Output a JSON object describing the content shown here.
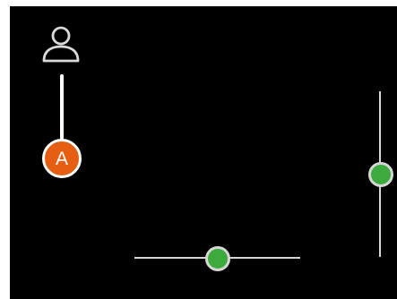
{
  "colors": {
    "screen_background": "#000000",
    "outer_background": "#ffffff",
    "badge_fill": "#e55e12",
    "badge_border": "#ffffff",
    "knob_fill": "#3daa3d",
    "knob_border": "#d6d6d6",
    "track": "#d8d8d8"
  },
  "icons": {
    "profile": "user-icon"
  },
  "badge": {
    "letter": "A"
  },
  "sliders": {
    "horizontal": {
      "value": 0.5
    },
    "vertical": {
      "value": 0.5
    }
  }
}
